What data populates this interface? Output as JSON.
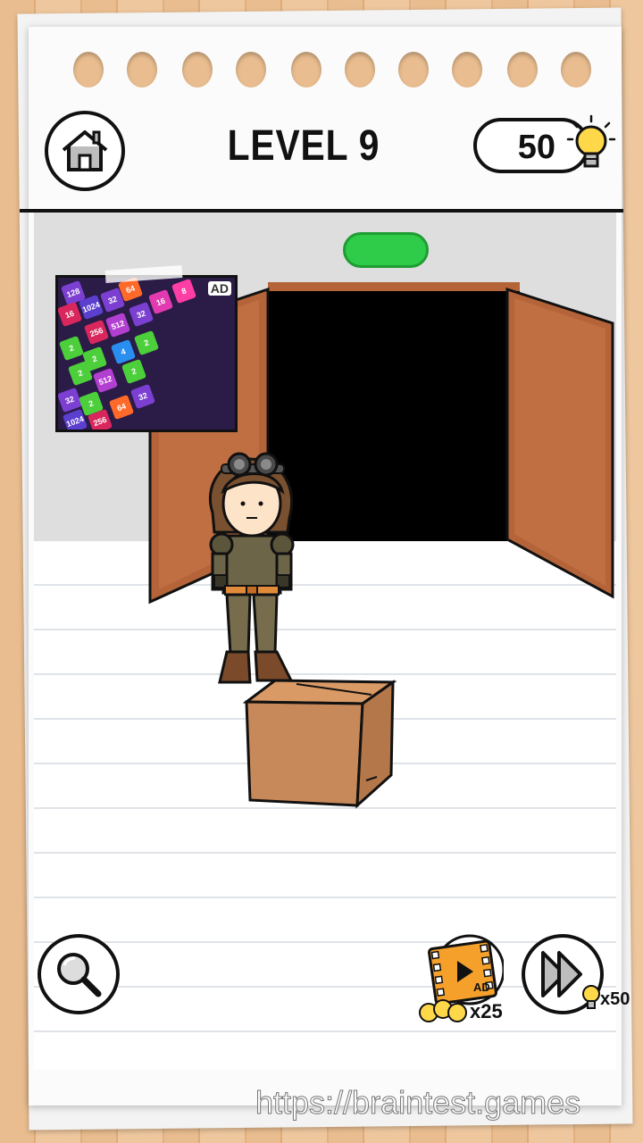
{
  "header": {
    "level_title": "LEVEL 9",
    "hint_count": "50"
  },
  "ad_board": {
    "ad_label": "AD",
    "tiles": [
      "128",
      "64",
      "8",
      "16",
      "1024",
      "32",
      "16",
      "256",
      "512",
      "32",
      "2",
      "2",
      "4",
      "2",
      "2",
      "512",
      "2",
      "32",
      "2",
      "64",
      "1024",
      "256",
      "32"
    ]
  },
  "footer": {
    "video_ad_badge": "AD",
    "video_reward": "x25",
    "skip_cost": "x50"
  },
  "watermark": "https://braintest.games",
  "colors": {
    "green_light": "#2fcc4a",
    "door": "#b5643a",
    "box": "#c8895a"
  }
}
